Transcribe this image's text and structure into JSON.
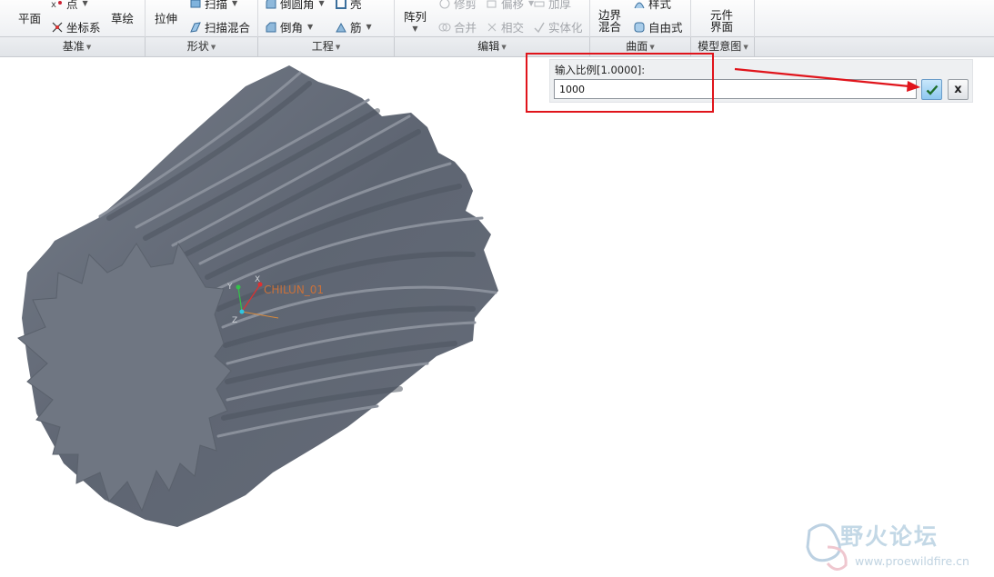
{
  "ribbon": {
    "datum": {
      "plane": "平面",
      "point": "点",
      "csys": "坐标系",
      "sketch": "草绘"
    },
    "shapes": {
      "extrude": "拉伸",
      "sweep": "扫描",
      "swept_blend": "扫描混合"
    },
    "engineering": {
      "round": "倒圆角",
      "chamfer": "倒角",
      "shell": "壳",
      "rib": "筋"
    },
    "editing": {
      "pattern": "阵列",
      "trim": "修剪",
      "merge": "合并",
      "offset": "偏移",
      "intersect": "相交",
      "thicken": "加厚",
      "solidify": "实体化"
    },
    "surfaces": {
      "boundary_blend": "边界\n混合",
      "style": "样式",
      "freestyle": "自由式"
    },
    "model_intent": {
      "component_interface": "元件\n界面"
    },
    "groups": {
      "datum": "基准",
      "shapes": "形状",
      "engineering": "工程",
      "editing": "编辑",
      "surfaces": "曲面",
      "model_intent": "模型意图"
    }
  },
  "viewport": {
    "csys_label": "CHILUN_01",
    "axis_x": "X",
    "axis_y": "Y",
    "axis_z": "Z"
  },
  "scale_dialog": {
    "prompt": "输入比例[1.0000]:",
    "value": "1000",
    "ok_icon": "check-icon",
    "cancel_label": "x"
  },
  "watermark": {
    "title": "野火论坛",
    "url": "www.proewildfire.cn"
  },
  "colors": {
    "gear": "#6d7480",
    "highlight": "#e0141b",
    "ok_button": "#8ec8f0"
  }
}
